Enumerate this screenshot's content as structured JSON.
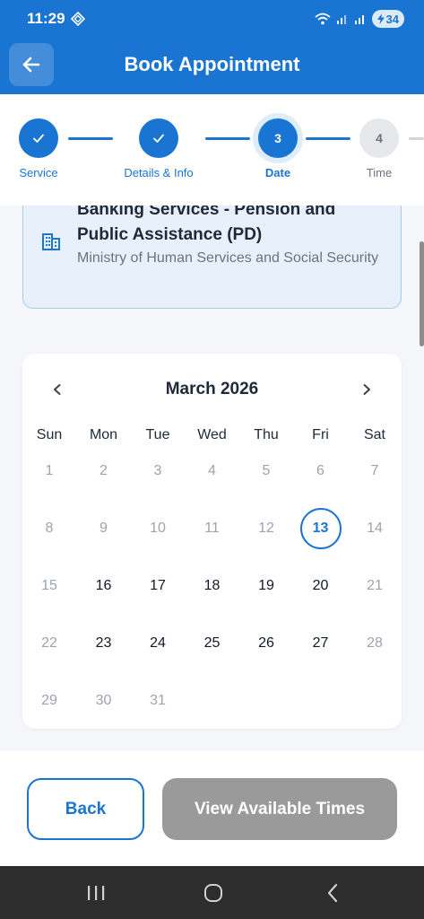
{
  "status_bar": {
    "time": "11:29",
    "battery": "34"
  },
  "header": {
    "title": "Book Appointment"
  },
  "stepper": {
    "steps": [
      {
        "number": "",
        "label": "Service",
        "state": "done"
      },
      {
        "number": "",
        "label": "Details & Info",
        "state": "done"
      },
      {
        "number": "3",
        "label": "Date",
        "state": "active"
      },
      {
        "number": "4",
        "label": "Time",
        "state": "todo"
      }
    ]
  },
  "service": {
    "name": "Banking Services - Pension and Public Assistance (PD)",
    "ministry": "Ministry of Human Services and Social Security"
  },
  "calendar": {
    "month": "March 2026",
    "weekdays": [
      "Sun",
      "Mon",
      "Tue",
      "Wed",
      "Thu",
      "Fri",
      "Sat"
    ],
    "days": [
      {
        "label": "1",
        "state": "disabled"
      },
      {
        "label": "2",
        "state": "disabled"
      },
      {
        "label": "3",
        "state": "disabled"
      },
      {
        "label": "4",
        "state": "disabled"
      },
      {
        "label": "5",
        "state": "disabled"
      },
      {
        "label": "6",
        "state": "disabled"
      },
      {
        "label": "7",
        "state": "disabled"
      },
      {
        "label": "8",
        "state": "disabled"
      },
      {
        "label": "9",
        "state": "disabled"
      },
      {
        "label": "10",
        "state": "disabled"
      },
      {
        "label": "11",
        "state": "disabled"
      },
      {
        "label": "12",
        "state": "disabled"
      },
      {
        "label": "13",
        "state": "selected"
      },
      {
        "label": "14",
        "state": "disabled"
      },
      {
        "label": "15",
        "state": "disabled"
      },
      {
        "label": "16",
        "state": "available"
      },
      {
        "label": "17",
        "state": "available"
      },
      {
        "label": "18",
        "state": "available"
      },
      {
        "label": "19",
        "state": "available"
      },
      {
        "label": "20",
        "state": "available"
      },
      {
        "label": "21",
        "state": "disabled"
      },
      {
        "label": "22",
        "state": "disabled"
      },
      {
        "label": "23",
        "state": "available"
      },
      {
        "label": "24",
        "state": "available"
      },
      {
        "label": "25",
        "state": "available"
      },
      {
        "label": "26",
        "state": "available"
      },
      {
        "label": "27",
        "state": "available"
      },
      {
        "label": "28",
        "state": "disabled"
      },
      {
        "label": "29",
        "state": "disabled"
      },
      {
        "label": "30",
        "state": "disabled"
      },
      {
        "label": "31",
        "state": "disabled"
      }
    ],
    "selected_day": "13"
  },
  "footer": {
    "back_label": "Back",
    "view_label": "View Available Times"
  },
  "colors": {
    "primary": "#1a75d2",
    "disabled_button": "#9a9a9a"
  },
  "icons": {
    "back": "arrow-left-icon",
    "building": "building-icon",
    "prev": "chevron-left-icon",
    "next": "chevron-right-icon",
    "check": "check-icon"
  }
}
